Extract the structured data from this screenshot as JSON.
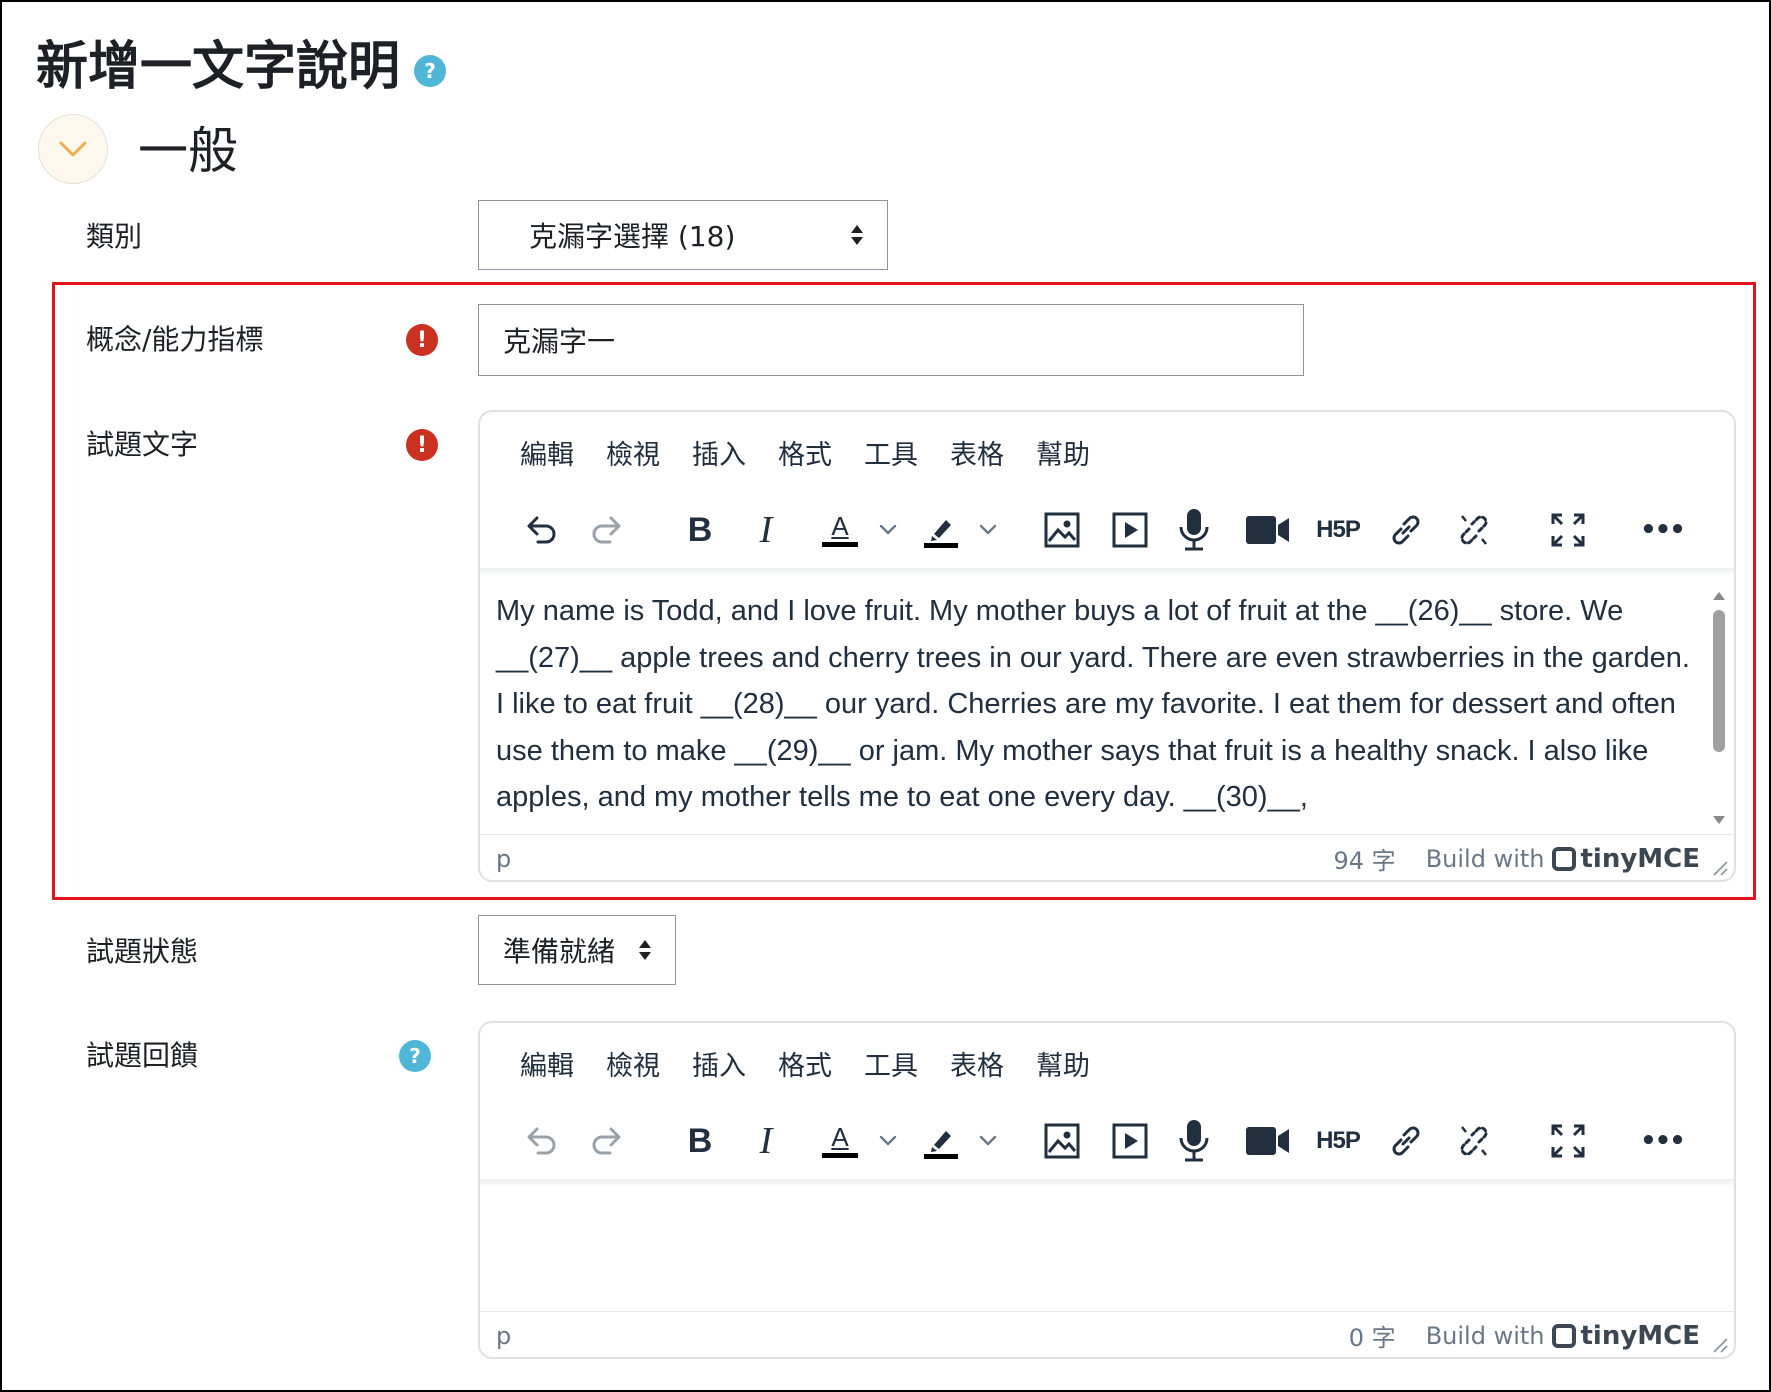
{
  "page": {
    "title": "新增一文字說明",
    "section_title": "一般"
  },
  "fields": {
    "category": {
      "label": "類別",
      "value": "克漏字選擇 (18)"
    },
    "concept": {
      "label": "概念/能力指標",
      "value": "克漏字一"
    },
    "question_text": {
      "label": "試題文字"
    },
    "status": {
      "label": "試題狀態",
      "value": "準備就緒"
    },
    "feedback": {
      "label": "試題回饋"
    }
  },
  "editor_menu": [
    "編輯",
    "檢視",
    "插入",
    "格式",
    "工具",
    "表格",
    "幫助"
  ],
  "toolbar_icons": [
    "undo-icon",
    "redo-icon",
    "bold-icon",
    "italic-icon",
    "text-color-icon",
    "highlight-color-icon",
    "image-icon",
    "media-icon",
    "microphone-icon",
    "video-camera-icon",
    "h5p-icon",
    "link-icon",
    "unlink-icon",
    "fullscreen-icon",
    "more-icon"
  ],
  "toolbar_text": {
    "bold": "B",
    "italic": "I",
    "text_color": "A",
    "h5p": "H5P",
    "more": "•••"
  },
  "question_editor": {
    "content": "My name is Todd, and I love fruit. My mother buys a lot of fruit at the __(26)__ store. We __(27)__ apple trees and cherry trees in our yard. There are even strawberries in the garden. I like to eat fruit __(28)__ our yard. Cherries are my favorite. I eat them for dessert and often use them to make __(29)__ or jam. My mother says that fruit is a healthy snack. I also like apples, and my mother tells me to eat one every day. __(30)__,",
    "path": "p",
    "word_count": "94 字",
    "build_with": "Build with",
    "brand": "tinyMCE"
  },
  "feedback_editor": {
    "content": "",
    "path": "p",
    "word_count": "0 字",
    "build_with": "Build with",
    "brand": "tinyMCE"
  },
  "colors": {
    "required": "#ca3120",
    "help": "#4fb6d8",
    "highlight_box": "#e3141b",
    "collapse_chevron": "#f0ad4e"
  }
}
